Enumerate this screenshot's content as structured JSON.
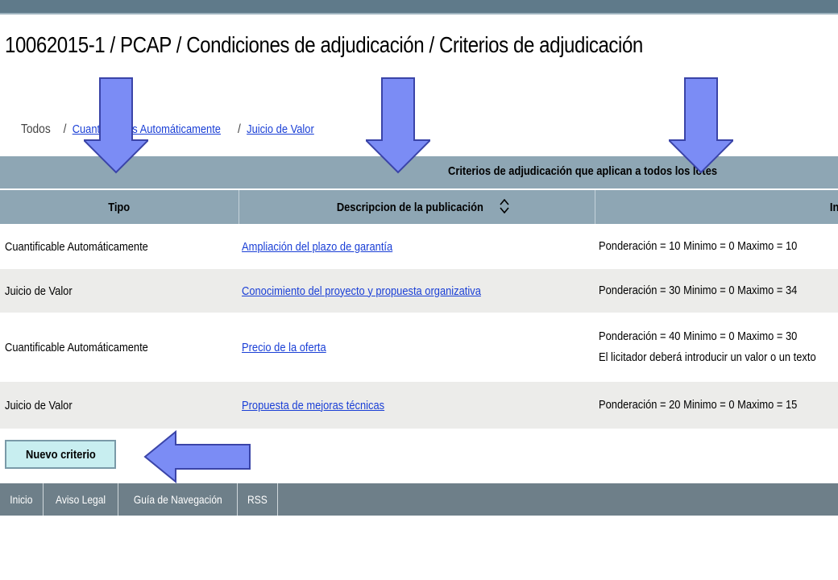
{
  "page": {
    "title": "10062015-1 / PCAP / Condiciones de adjudicación / Criterios de adjudicación"
  },
  "filters": {
    "all_label": "Todos",
    "sep1": "/",
    "auto_label": "Cuantificables Automáticamente",
    "sep2": "/",
    "juicio_label": "Juicio de Valor"
  },
  "table": {
    "group_header": "Criterios de adjudicación que aplican a todos los lotes",
    "columns": {
      "tipo": "Tipo",
      "descripcion": "Descripcion de la publicación",
      "info": "In"
    },
    "rows": [
      {
        "tipo": "Cuantificable Automáticamente",
        "descripcion": "Ampliación del plazo de garantía",
        "info": "Ponderación = 10 Minimo = 0 Maximo = 10",
        "info2": ""
      },
      {
        "tipo": "Juicio de Valor",
        "descripcion": "Conocimiento del proyecto y propuesta organizativa",
        "info": "Ponderación = 30 Minimo = 0 Maximo = 34",
        "info2": ""
      },
      {
        "tipo": "Cuantificable Automáticamente",
        "descripcion": "Precio de la oferta",
        "info": "Ponderación = 40 Minimo = 0 Maximo = 30",
        "info2": "El licitador deberá introducir un valor o un texto"
      },
      {
        "tipo": "Juicio de Valor",
        "descripcion": "Propuesta de mejoras técnicas",
        "info": "Ponderación = 20 Minimo = 0 Maximo = 15",
        "info2": ""
      }
    ]
  },
  "buttons": {
    "new_criterion": "Nuevo criterio"
  },
  "footer": {
    "links": [
      "Inicio",
      "Aviso Legal",
      "Guía de Navegación",
      "RSS"
    ]
  },
  "colors": {
    "header_bg": "#8ea6b4",
    "link": "#1a3fd6",
    "arrow_fill": "#7b8cf5",
    "footer_bg": "#6e7f89",
    "button_bg": "#c8eef0"
  },
  "icons": {
    "sort": "sort-updown-icon",
    "annotation_arrow": "arrow-down-icon"
  }
}
